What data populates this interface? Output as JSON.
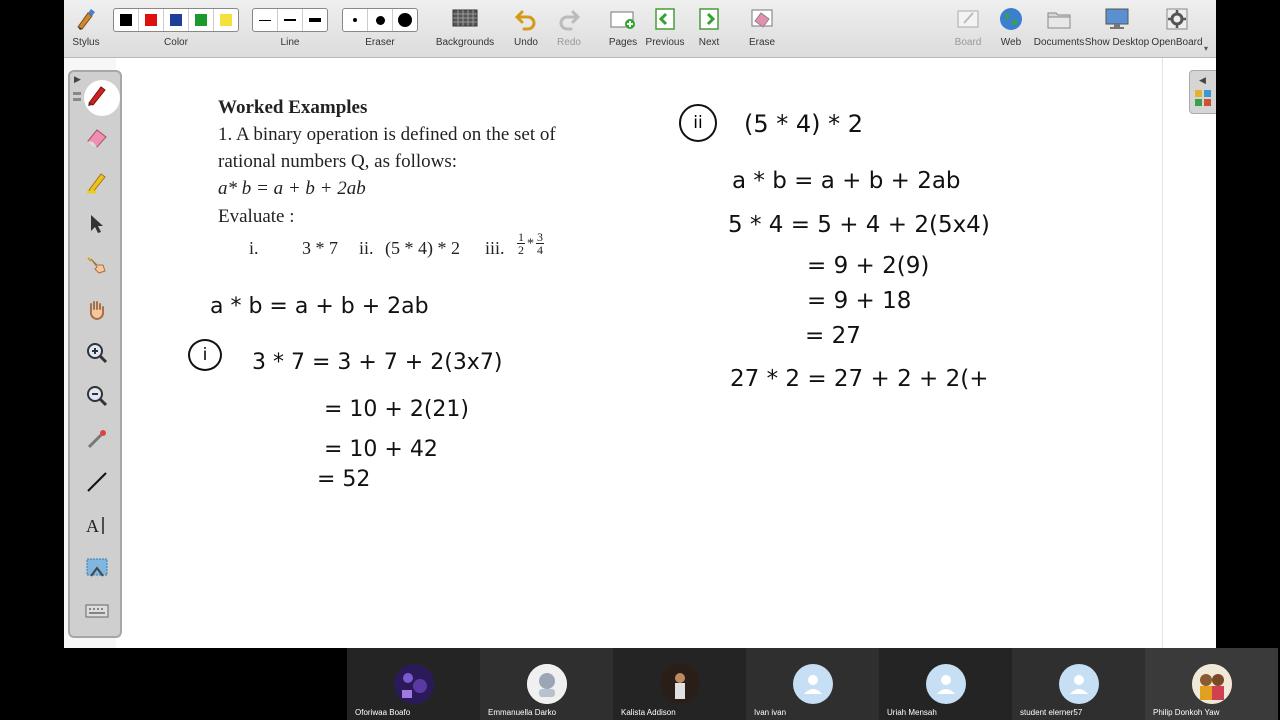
{
  "toolbar": {
    "stylus": "Stylus",
    "color": "Color",
    "line": "Line",
    "eraser": "Eraser",
    "backgrounds": "Backgrounds",
    "undo": "Undo",
    "redo": "Redo",
    "pages": "Pages",
    "previous": "Previous",
    "next": "Next",
    "erase": "Erase",
    "board": "Board",
    "web": "Web",
    "documents": "Documents",
    "show_desktop": "Show Desktop",
    "openboard": "OpenBoard",
    "colors": [
      "#000000",
      "#e01010",
      "#1c3f9a",
      "#1a9a2a",
      "#f5e13a"
    ]
  },
  "document": {
    "heading": "Worked Examples",
    "line1": "1. A binary operation is defined on the set of",
    "line2": "rational numbers Q, as follows:",
    "definition": "a* b = a + b + 2ab",
    "evaluate": "Evaluate :",
    "items": {
      "i_label": "i.",
      "i_expr": "3 * 7",
      "ii_label": "ii.",
      "ii_expr": "(5 * 4) * 2",
      "iii_label": "iii.",
      "iii_frac1_num": "1",
      "iii_frac1_den": "2",
      "iii_star": "*",
      "iii_frac2_num": "3",
      "iii_frac2_den": "4"
    }
  },
  "handwriting": {
    "left": {
      "definition": "a * b = a + b + 2ab",
      "marker": "i",
      "step1": "3 * 7  = 3 + 7 + 2(3x7)",
      "step2": "=   10  + 2(21)",
      "step3": "=   10  + 42",
      "step4": "=   52"
    },
    "right": {
      "marker": "ii",
      "problem": "(5 * 4) * 2",
      "definition": "a * b  = a + b + 2ab",
      "step1": "5 * 4  = 5 + 4 + 2(5x4)",
      "step2": "=   9   + 2(9)",
      "step3": "=   9   + 18",
      "step4": "=    27",
      "step5": "27 * 2   = 27 + 2  + 2(+"
    }
  },
  "participants": [
    {
      "name": "Oforiwaa Boafo",
      "avatar": "photo",
      "color": "#3a2a6a"
    },
    {
      "name": "Emmanuella Darko",
      "avatar": "photo",
      "color": "#e8e8e8"
    },
    {
      "name": "Kalista Addison",
      "avatar": "photo",
      "color": "#3a2a20"
    },
    {
      "name": "Ivan ivan",
      "avatar": "person-icon",
      "color": "#c7dff5"
    },
    {
      "name": "Uriah Mensah",
      "avatar": "person-icon",
      "color": "#c7dff5"
    },
    {
      "name": "student elerner57",
      "avatar": "person-icon",
      "color": "#c7dff5"
    },
    {
      "name": "Philip Donkoh Yaw",
      "avatar": "photo",
      "color": "#d0a060"
    }
  ]
}
